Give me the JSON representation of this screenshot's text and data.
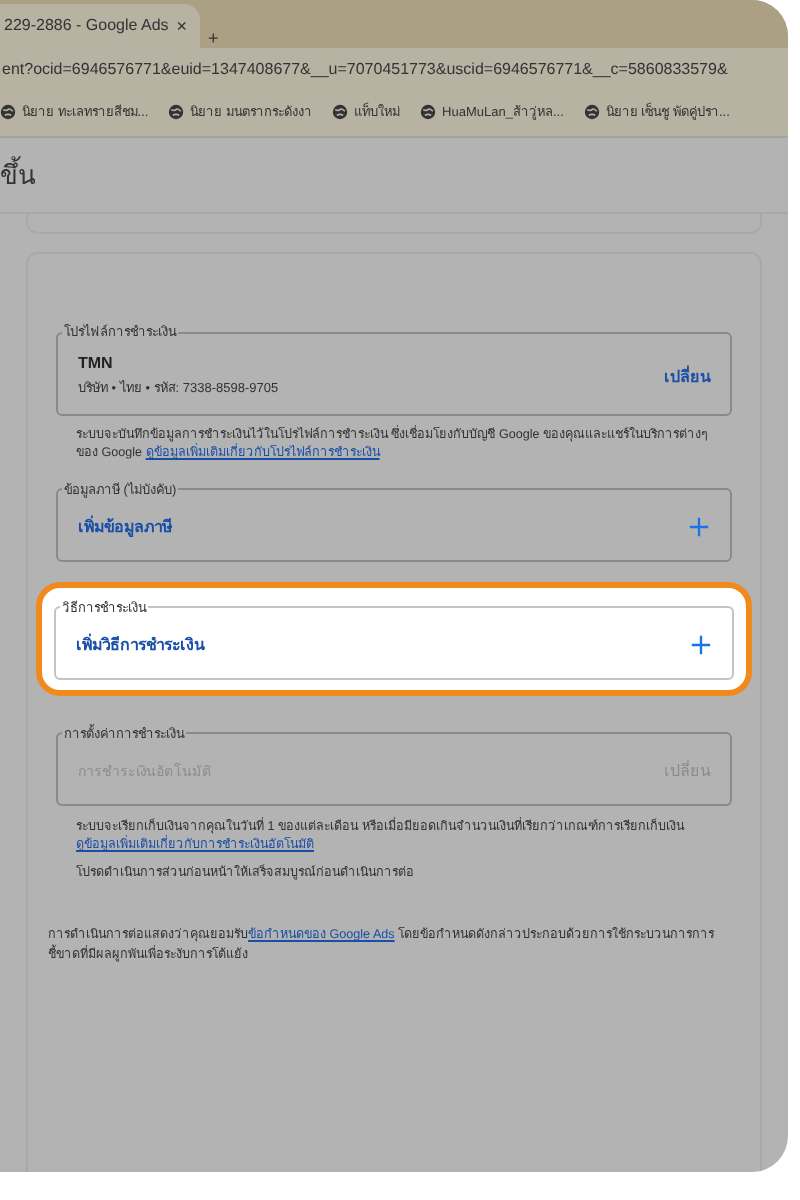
{
  "browser": {
    "tab_title": "229-2886 - Google Ads",
    "tab_close": "×",
    "new_tab": "+",
    "url": "ent?ocid=6946576771&euid=1347408677&__u=7070451773&uscid=6946576771&__c=5860833579&",
    "bookmarks": [
      "นิยาย ทะเลทรายสีชม...",
      "นิยาย มนตรากระดังงา",
      "แท็บใหม่",
      "HuaMuLan_ส้าวู่หล...",
      "นิยาย เซ็นชู พัดคู่ปรา..."
    ]
  },
  "page_title": "ขึ้น",
  "payment_profile": {
    "legend": "โปรไฟล์การชำระเงิน",
    "name": "TMN",
    "details": "บริษัท • ไทย • รหัส: 7338-8598-9705",
    "action": "เปลี่ยน",
    "note": "ระบบจะบันทึกข้อมูลการชำระเงินไว้ในโปรไฟล์การชำระเงิน ซึ่งเชื่อมโยงกับบัญชี Google ของคุณและแชร์ในบริการต่างๆ ของ Google ",
    "note_link": "ดูข้อมูลเพิ่มเติมเกี่ยวกับโปรไฟล์การชำระเงิน"
  },
  "tax_info": {
    "legend": "ข้อมูลภาษี (ไม่บังคับ)",
    "action": "เพิ่มข้อมูลภาษี"
  },
  "payment_method": {
    "legend": "วิธีการชำระเงิน",
    "action": "เพิ่มวิธีการชำระเงิน"
  },
  "payment_settings": {
    "legend": "การตั้งค่าการชำระเงิน",
    "value": "การชำระเงินอัตโนมัติ",
    "action": "เปลี่ยน",
    "disabled": true,
    "note": "ระบบจะเรียกเก็บเงินจากคุณในวันที่ 1 ของแต่ละเดือน หรือเมื่อมียอดเกินจำนวนเงินที่เรียกว่าเกณฑ์การเรียกเก็บเงิน ",
    "note_link": "ดูข้อมูลเพิ่มเติมเกี่ยวกับการชำระเงินอัตโนมัติ",
    "hint": "โปรดดำเนินการส่วนก่อนหน้าให้เสร็จสมบูรณ์ก่อนดำเนินการต่อ"
  },
  "terms": {
    "before": "การดำเนินการต่อแสดงว่าคุณยอมรับ",
    "link": "ข้อกำหนดของ Google Ads",
    "after": " โดยข้อกำหนดดังกล่าวประกอบด้วยการใช้กระบวนการการชี้ขาดที่มีผลผูกพันเพื่อระงับการโต้แย้ง"
  }
}
